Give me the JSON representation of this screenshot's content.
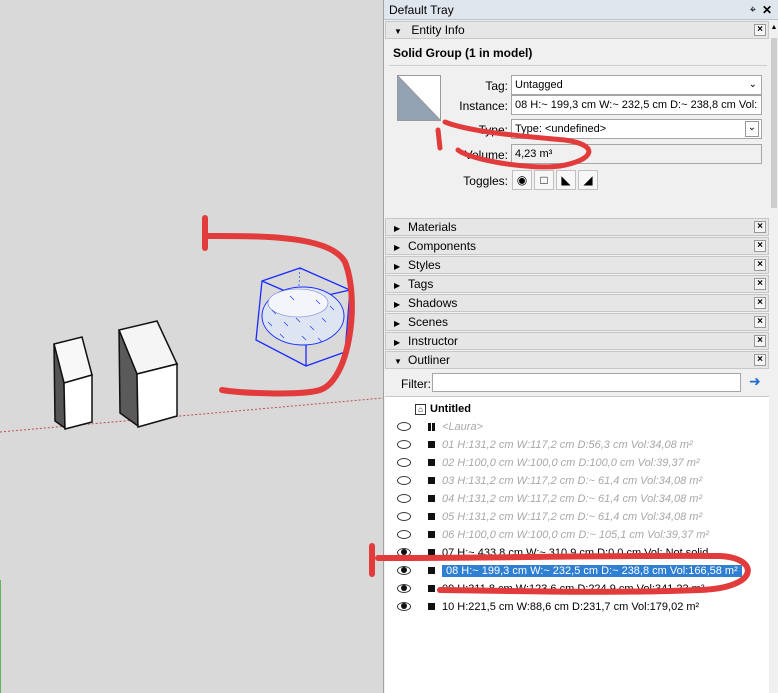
{
  "tray": {
    "title": "Default Tray",
    "pin_glyph": "⌖",
    "close_glyph": "✕"
  },
  "entity_info": {
    "header": "Entity Info",
    "title": "Solid Group (1 in model)",
    "tag_label": "Tag:",
    "tag_value": "Untagged",
    "instance_label": "Instance:",
    "instance_value": "08 H:~ 199,3 cm W:~ 232,5 cm D:~ 238,8 cm Vol:",
    "type_label": "Type:",
    "type_value": "Type: <undefined>",
    "volume_label": "Volume:",
    "volume_value": "4,23 m³",
    "toggles_label": "Toggles:"
  },
  "panels": [
    "Materials",
    "Components",
    "Styles",
    "Tags",
    "Shadows",
    "Scenes",
    "Instructor"
  ],
  "outliner": {
    "header": "Outliner",
    "filter_label": "Filter:",
    "filter_value": "",
    "root": "Untitled",
    "items": [
      {
        "text": "<Laura>",
        "visible": true,
        "hidden": true,
        "component": true
      },
      {
        "text": "01 H:131,2 cm W:117,2 cm D:56,3 cm Vol:34,08 m²",
        "visible": true,
        "hidden": true
      },
      {
        "text": "02 H:100,0 cm W:100,0 cm D:100,0 cm Vol:39,37 m²",
        "visible": true,
        "hidden": true
      },
      {
        "text": "03 H:131,2 cm W:117,2 cm D:~ 61,4 cm Vol:34,08 m²",
        "visible": true,
        "hidden": true
      },
      {
        "text": "04 H:131,2 cm W:117,2 cm D:~ 61,4 cm Vol:34,08 m²",
        "visible": true,
        "hidden": true
      },
      {
        "text": "05 H:131,2 cm W:117,2 cm D:~ 61,4 cm Vol:34,08 m²",
        "visible": true,
        "hidden": true
      },
      {
        "text": "06 H:100,0 cm W:100,0 cm D:~ 105,1 cm Vol:39,37 m²",
        "visible": true,
        "hidden": true
      },
      {
        "text": "07 H:~ 433,8 cm W:~ 310,9 cm D:0,0 cm Vol: Not solid",
        "visible": true,
        "hidden": false
      },
      {
        "text": "08 H:~ 199,3 cm W:~ 232,5 cm D:~ 238,8 cm Vol:166,58 m²",
        "visible": true,
        "hidden": false,
        "selected": true
      },
      {
        "text": "09 H:311,8 cm W:123,6 cm D:224,9 cm Vol:341,23 m²",
        "visible": true,
        "hidden": false
      },
      {
        "text": "10 H:221,5 cm W:88,6 cm D:231,7 cm Vol:179,02 m²",
        "visible": true,
        "hidden": false
      }
    ]
  },
  "colors": {
    "selection": "#2f7fd3",
    "annotation": "#e23b3b",
    "bbox": "#1a2cff",
    "axis_green": "#3aa63a",
    "axis_red": "#c05050"
  }
}
